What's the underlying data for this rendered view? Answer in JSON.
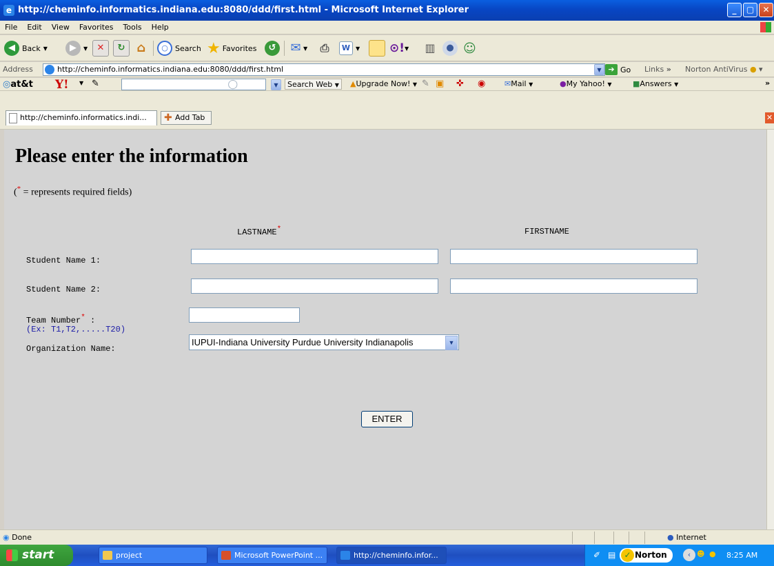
{
  "window": {
    "title": "http://cheminfo.informatics.indiana.edu:8080/ddd/first.html - Microsoft Internet Explorer"
  },
  "menu": [
    "File",
    "Edit",
    "View",
    "Favorites",
    "Tools",
    "Help"
  ],
  "toolbar": {
    "back": "Back",
    "search": "Search",
    "favorites": "Favorites"
  },
  "address": {
    "label": "Address",
    "url": "http://cheminfo.informatics.indiana.edu:8080/ddd/first.html",
    "go": "Go",
    "links": "Links",
    "norton": "Norton AntiVirus"
  },
  "yahoo": {
    "att": "at&t",
    "search_web": "Search Web",
    "upgrade": "Upgrade Now!",
    "mail": "Mail",
    "my_yahoo": "My Yahoo!",
    "answers": "Answers"
  },
  "tabs": {
    "current": "http://cheminfo.informatics.indi...",
    "add": "Add Tab"
  },
  "page": {
    "heading": "Please enter the information",
    "note_open": "(",
    "note_star": "*",
    "note_rest": " = represents required fields)",
    "col_lastname": "LASTNAME",
    "col_firstname": "FIRSTNAME",
    "student1_label": "Student Name 1:",
    "student2_label": "Student Name 2:",
    "team_label": "Team Number",
    "team_colon": " :",
    "team_hint": "(Ex: T1,T2,.....T20)",
    "org_label": "Organization Name:",
    "org_value": "IUPUI-Indiana University Purdue University Indianapolis",
    "enter_button": "ENTER",
    "star": "*"
  },
  "status": {
    "text": "Done",
    "zone": "Internet"
  },
  "taskbar": {
    "start": "start",
    "items": [
      "project",
      "Microsoft PowerPoint ...",
      "http://cheminfo.infor..."
    ],
    "norton": "Norton",
    "clock": "8:25 AM"
  }
}
